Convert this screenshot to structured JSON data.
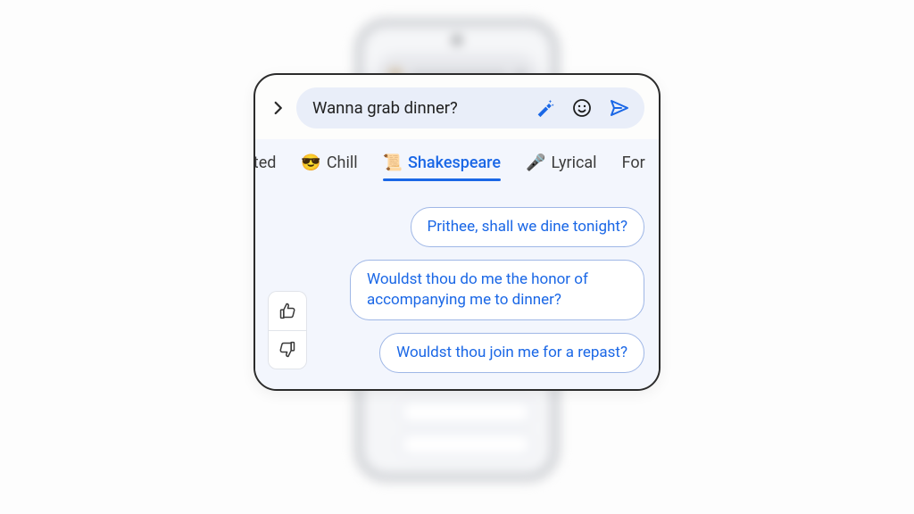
{
  "compose": {
    "draft_text": "Wanna grab dinner?"
  },
  "tabs": {
    "partial_left": "cited",
    "chill": {
      "emoji": "😎",
      "label": "Chill"
    },
    "shakespeare": {
      "emoji": "📜",
      "label": "Shakespeare"
    },
    "lyrical": {
      "emoji": "🎤",
      "label": "Lyrical"
    },
    "partial_right": "For"
  },
  "suggestions": [
    "Prithee, shall we dine tonight?",
    "Wouldst thou do me the honor of accompanying me to dinner?",
    "Wouldst thou join me for a repast?"
  ],
  "icons": {
    "expand": "chevron-right-icon",
    "magic": "magic-rewrite-icon",
    "emoji": "emoji-icon",
    "send": "send-icon",
    "thumbs_up": "thumbs-up-icon",
    "thumbs_down": "thumbs-down-icon"
  },
  "colors": {
    "accent": "#1a67e6",
    "panel_bg": "#f3f6fd",
    "input_bg": "#e9eef9"
  }
}
